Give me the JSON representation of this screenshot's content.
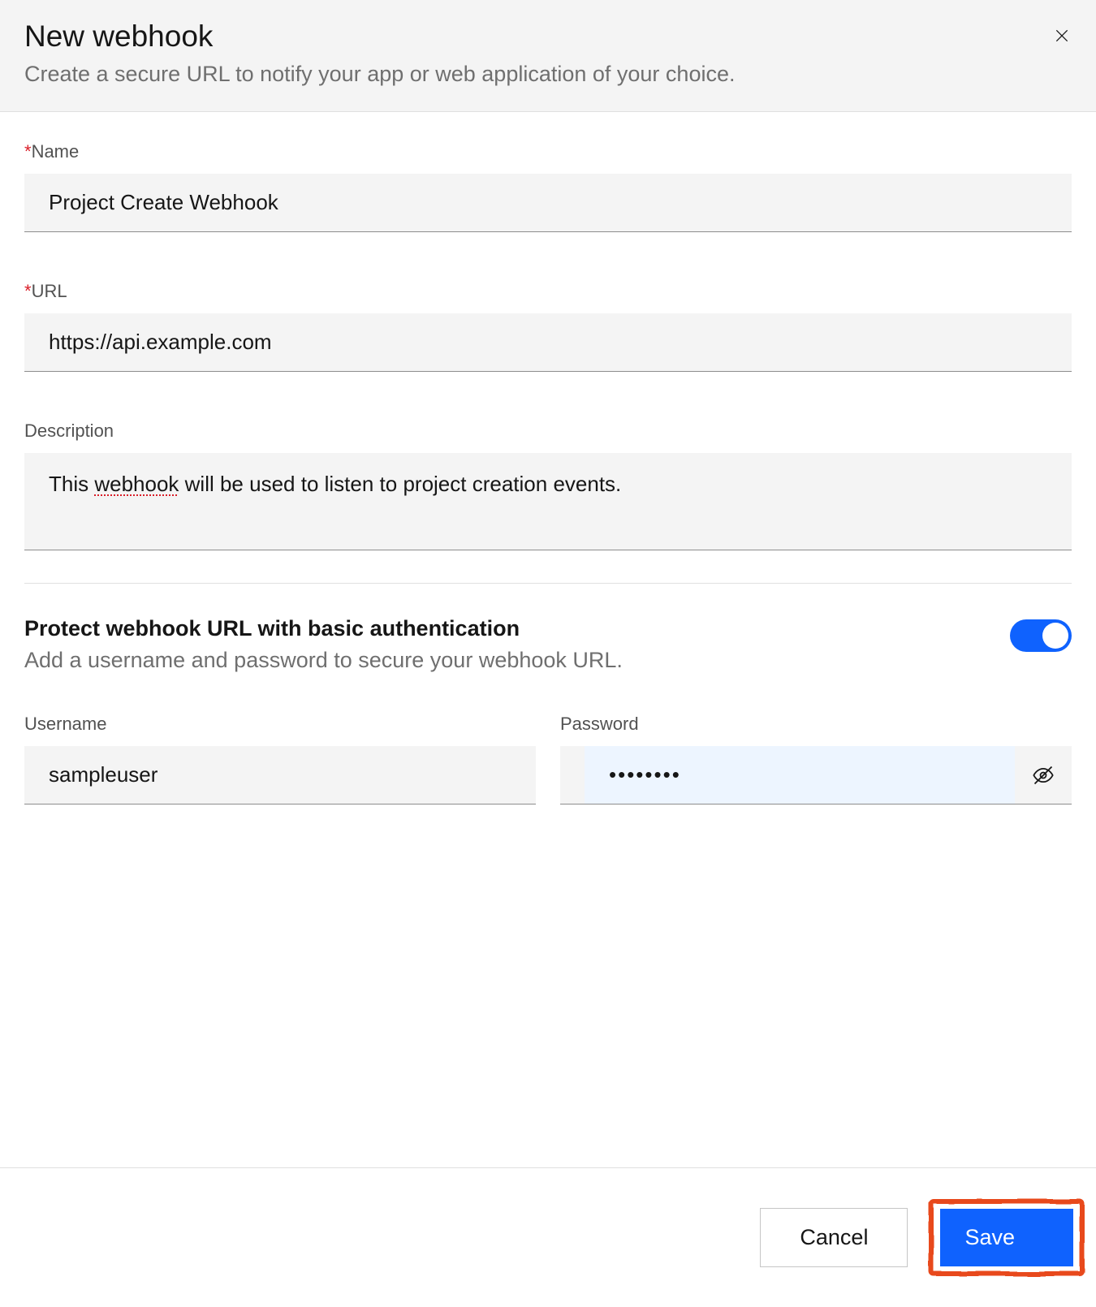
{
  "header": {
    "title": "New webhook",
    "subtitle": "Create a secure URL to notify your app or web application of your choice."
  },
  "form": {
    "name": {
      "label": "Name",
      "value": "Project Create Webhook"
    },
    "url": {
      "label": "URL",
      "value": "https://api.example.com"
    },
    "description": {
      "label": "Description",
      "value_prefix": "This ",
      "value_spellcheck": "webhook",
      "value_suffix": " will be used to listen to project creation events."
    }
  },
  "auth": {
    "title": "Protect webhook URL with basic authentication",
    "subtitle": "Add a username and password to secure your webhook URL.",
    "enabled": true,
    "username": {
      "label": "Username",
      "value": "sampleuser"
    },
    "password": {
      "label": "Password",
      "value": "••••••••"
    }
  },
  "actions": {
    "cancel": "Cancel",
    "save": "Save"
  }
}
